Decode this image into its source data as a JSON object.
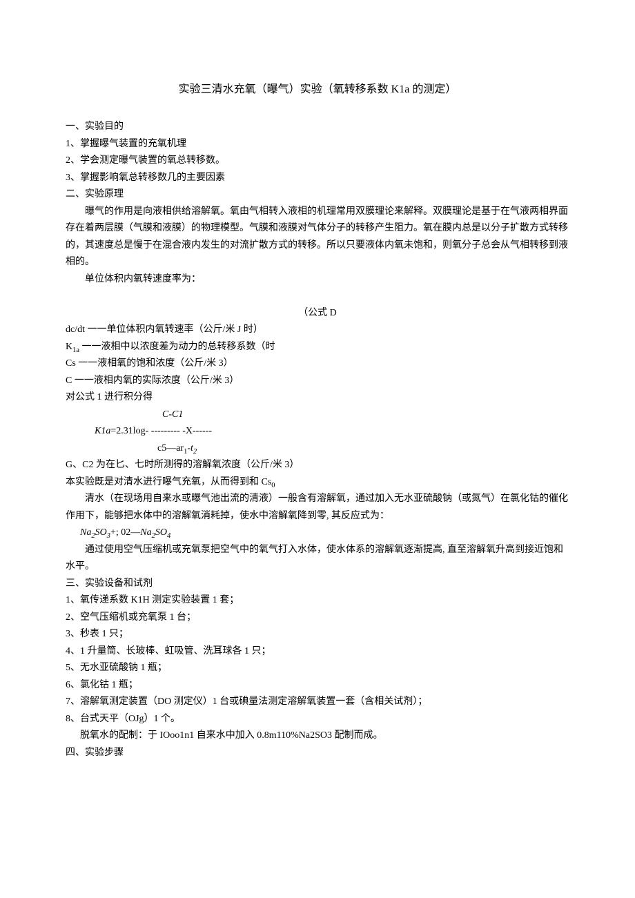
{
  "title": "实验三清水充氧（曝气）实验（氧转移系数 K1a 的测定）",
  "sections": {
    "s1": {
      "heading": "一、实验目的",
      "items": [
        "1、掌握曝气装置的充氧机理",
        "2、学会测定曝气装置的氧总转移数。",
        "3、掌握影响氧总转移数几的主要因素"
      ]
    },
    "s2": {
      "heading": "二、实验原理",
      "p1": "曝气的作用是向液相供给溶解氧。氧由气相转入液相的机理常用双膜理论来解释。双膜理论是基于在气液两相界面存在着两层膜（气膜和液膜）的物理模型。气膜和液膜对气体分子的转移产生阻力。氧在膜内总是以分子扩散方式转移的，其速度总是慢于在混合液内发生的对流扩散方式的转移。所以只要液体内氧未饱和，则氧分子总会从气相转移到液相的。",
      "p2": "单位体积内氧转速度率为：",
      "formula_label": "（公式 D",
      "defs": [
        "dc/dt 一一单位体积内氧转速率（公斤/米 J 时）",
        "K1a 一一液相中以浓度差为动力的总转移系数（时",
        "Cs 一一液相氧的饱和浓度（公斤/米 3）",
        "C 一一液相内氧的实际浓度（公斤/米 3）"
      ],
      "p3": "对公式 1 进行积分得",
      "frac_top": "C-C1",
      "frac_mid_left": "K1a",
      "frac_mid_right": "=2.31log- --------- -X------",
      "frac_bot": "c5—ar1-t2",
      "p4": "G、C2 为在匕、七时所测得的溶解氧浓度（公斤/米 3）",
      "p5": "本实验既是对清水进行曝气充氧，从而得到和 Cs0",
      "p6": "清水（在现场用自来水或曝气池出流的清液）一般含有溶解氧，通过加入无水亚硫酸钠（或氮气）在氯化钴的催化作用下，能够把水体中的溶解氧消耗掉，使水中溶解氧降到零, 其反应式为：",
      "eq_left": "Na2SO3",
      "eq_mid": "+;  O2—",
      "eq_right": "Na2SO4",
      "p7": "通过使用空气压缩机或充氧泵把空气中的氧气打入水体，使水体系的溶解氧逐渐提高, 直至溶解氧升高到接近饱和水平。"
    },
    "s3": {
      "heading": "三、实验设备和试剂",
      "items": [
        "1、氧传递系数 K1H 测定实验装置 1 套；",
        "2、空气压缩机或充氧泵 1 台；",
        "3、秒表 1 只；",
        "4、1 升量筒、长玻棒、虹吸管、洗耳球各 1 只；",
        "5、无水亚硫酸钠 1 瓶；",
        "6、氯化钴 1 瓶；",
        "7、溶解氧测定装置（DO 测定仪）1 台或碘量法测定溶解氧装置一套（含相关试剂）；",
        "8、台式天平（OJg）1 个。"
      ],
      "note": "脱氧水的配制：于 IOoo1n1 自来水中加入 0.8m110%Na2SO3 配制而成。"
    },
    "s4": {
      "heading": "四、实验步骤"
    }
  }
}
